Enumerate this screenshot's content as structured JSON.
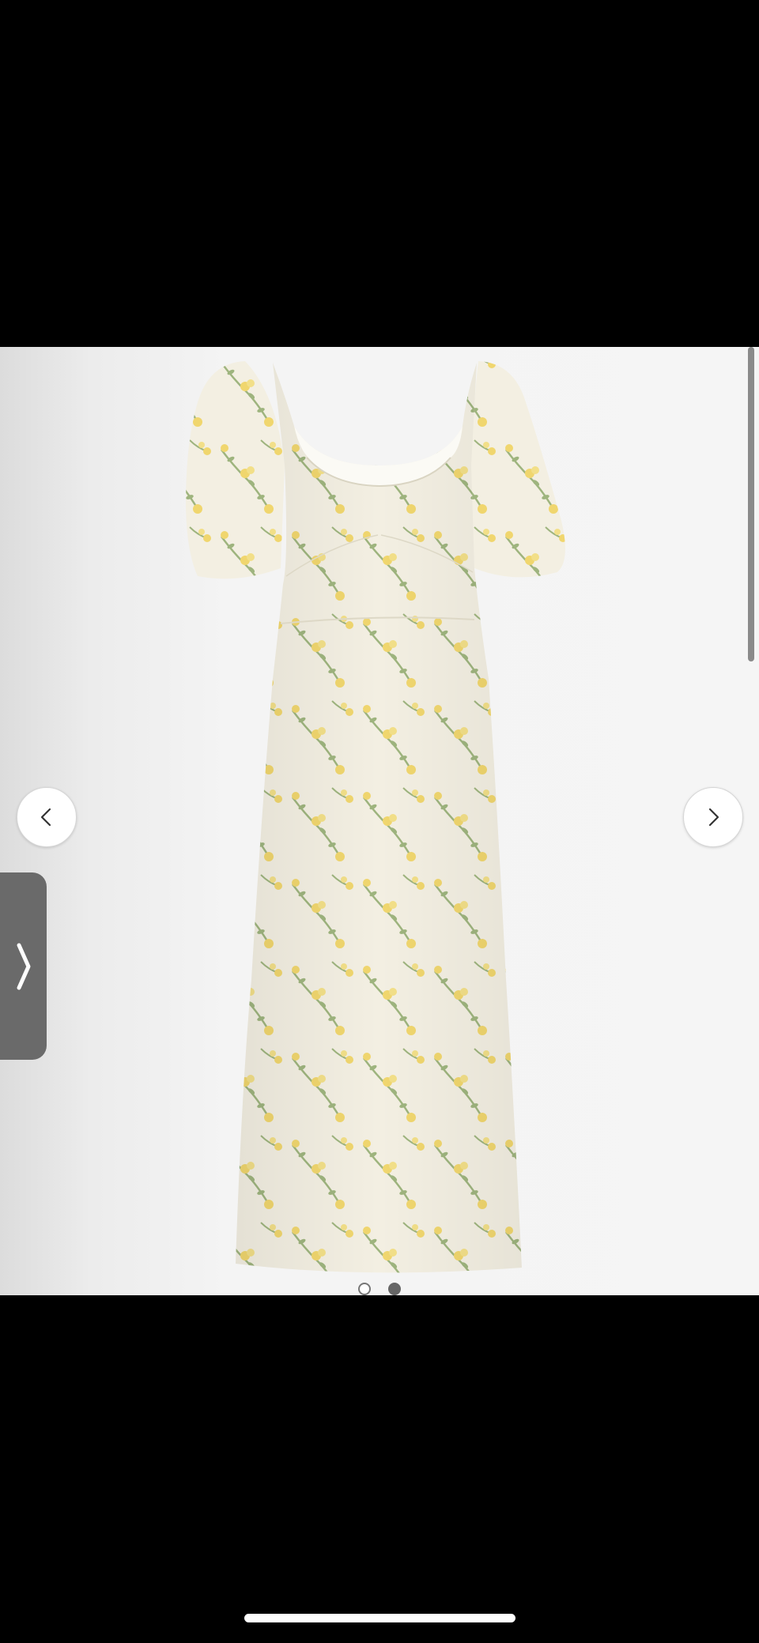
{
  "product_image": {
    "alt": "",
    "background_color": "#f5f5f5",
    "dress_color": "#f3efe2",
    "flower_color": "#efd25a",
    "leaf_color": "#8faa6c"
  },
  "carousel": {
    "prev_icon": "chevron-left-icon",
    "next_icon": "chevron-right-icon",
    "total_images": 2,
    "active_index": 2
  },
  "side_tab": {
    "icon": "chevron-right-icon",
    "color": "#6a6a6a"
  },
  "system": {
    "home_indicator_color": "#ffffff"
  }
}
